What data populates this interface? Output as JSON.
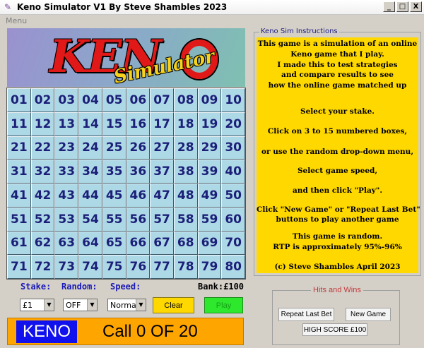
{
  "window": {
    "title": "Keno Simulator V1 By Steve Shambles 2023",
    "minimize": "_",
    "maximize": "□",
    "close": "X"
  },
  "menu": {
    "label": "Menu"
  },
  "logo": {
    "word": "KEN",
    "sub": "Simulator"
  },
  "grid": {
    "numbers": [
      "01",
      "02",
      "03",
      "04",
      "05",
      "06",
      "07",
      "08",
      "09",
      "10",
      "11",
      "12",
      "13",
      "14",
      "15",
      "16",
      "17",
      "18",
      "19",
      "20",
      "21",
      "22",
      "23",
      "24",
      "25",
      "26",
      "27",
      "28",
      "29",
      "30",
      "31",
      "32",
      "33",
      "34",
      "35",
      "36",
      "37",
      "38",
      "39",
      "40",
      "41",
      "42",
      "43",
      "44",
      "45",
      "46",
      "47",
      "48",
      "49",
      "50",
      "51",
      "52",
      "53",
      "54",
      "55",
      "56",
      "57",
      "58",
      "59",
      "60",
      "61",
      "62",
      "63",
      "64",
      "65",
      "66",
      "67",
      "68",
      "69",
      "70",
      "71",
      "72",
      "73",
      "74",
      "75",
      "76",
      "77",
      "78",
      "79",
      "80"
    ]
  },
  "controls": {
    "stake_label": "Stake:",
    "random_label": "Random:",
    "speed_label": "Speed:",
    "bank": "Bank:£100",
    "stake_value": "£1",
    "random_value": "OFF",
    "speed_value": "Normal",
    "clear": "Clear",
    "play": "Play"
  },
  "status": {
    "keno": "KENO",
    "call": "Call 0 OF 20"
  },
  "instructions": {
    "title": "Keno Sim Instructions",
    "lines": [
      "This game is a simulation of an online",
      "Keno game that I play.",
      "I made this to test strategies",
      "and compare results to see",
      "how the online game matched up",
      "Select your stake.",
      "Click on 3 to 15 numbered boxes,",
      "or use the random drop-down menu,",
      "Select game speed,",
      "and then click \"Play\".",
      "Click \"New Game\" or \"Repeat Last Bet\"",
      "buttons to play another game",
      "This game is random.",
      "RTP is approximately 95%-96%",
      "(c) Steve Shambles April 2023"
    ]
  },
  "hits": {
    "title": "Hits and Wins",
    "repeat": "Repeat Last Bet",
    "new_game": "New  Game",
    "high_score": "HIGH SCORE £100"
  }
}
